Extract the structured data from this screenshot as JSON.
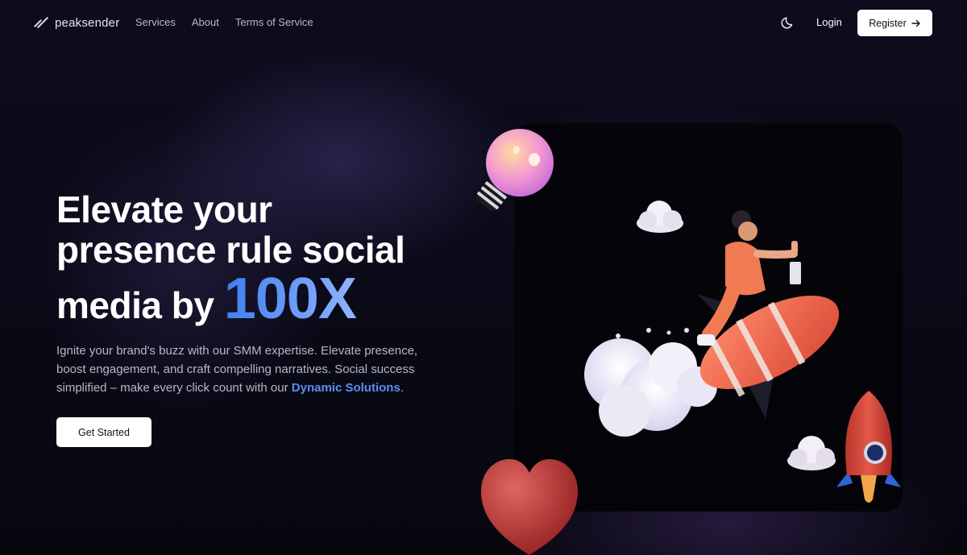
{
  "brand": {
    "name": "peaksender"
  },
  "nav": {
    "links": [
      "Services",
      "About",
      "Terms of Service"
    ],
    "login_label": "Login",
    "register_label": "Register",
    "theme_icon": "moon-icon"
  },
  "hero": {
    "headline_line1": "Elevate your",
    "headline_line2": "presence rule social",
    "headline_line3_prefix": "media by",
    "headline_accent": "100X",
    "subtitle": "Ignite your brand's buzz with our SMM expertise. Elevate presence, boost engagement, and craft compelling narratives. Social success simplified – make every click count with our",
    "subtitle_link": "Dynamic Solutions",
    "subtitle_end": ".",
    "cta_label": "Get Started"
  },
  "colors": {
    "background": "#06060f",
    "accent_blue": "#3f7ff0",
    "button_bg": "#ffffff"
  }
}
